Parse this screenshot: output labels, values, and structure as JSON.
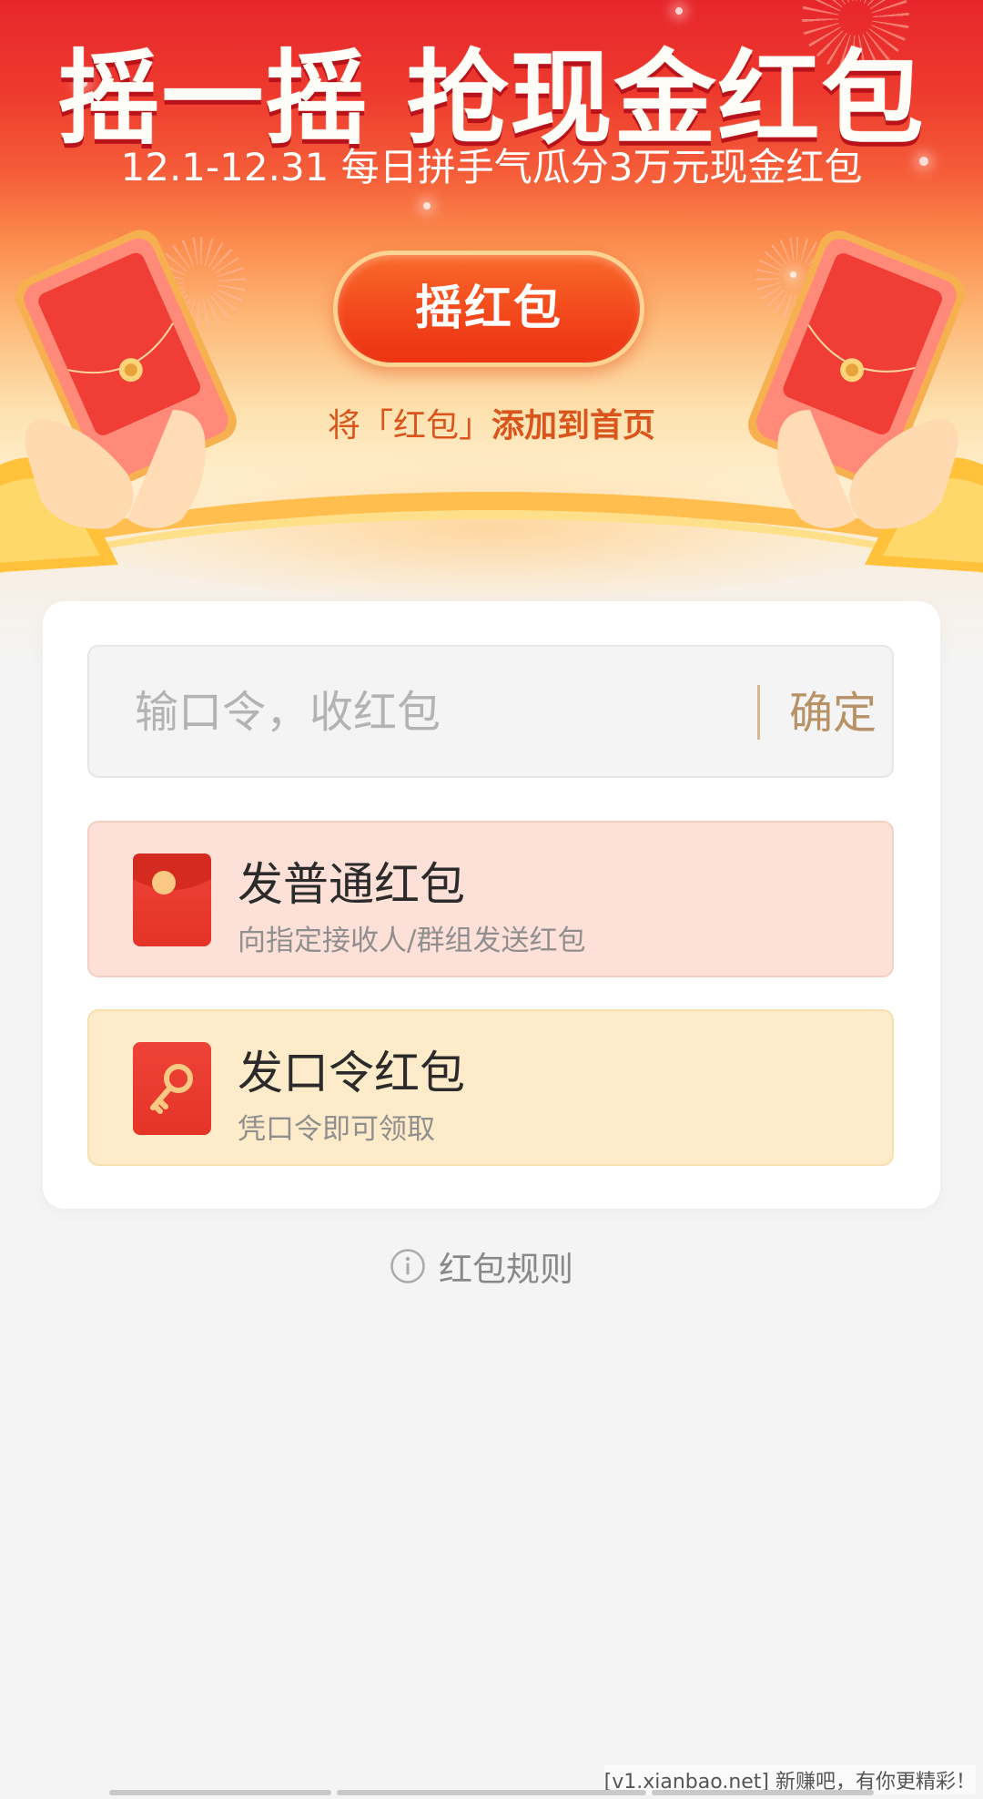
{
  "hero": {
    "title": "摇一摇 抢现金红包",
    "subtitle": "12.1-12.31 每日拼手气瓜分3万元现金红包",
    "shake_button": "摇红包",
    "add_home_prefix": "将「红包」",
    "add_home_link": "添加到首页"
  },
  "code_box": {
    "placeholder": "输口令，收红包",
    "value": "",
    "confirm_label": "确定"
  },
  "options": [
    {
      "title": "发普通红包",
      "desc": "向指定接收人/群组发送红包",
      "icon": "red-envelope-icon"
    },
    {
      "title": "发口令红包",
      "desc": "凭口令即可领取",
      "icon": "key-icon"
    }
  ],
  "rules": {
    "label": "红包规则",
    "icon": "info-icon"
  },
  "watermark": "[v1.xianbao.net] 新赚吧，有你更精彩！",
  "colors": {
    "primary_red": "#e53328",
    "accent_orange": "#f2451b",
    "gold_text": "#b89267",
    "background": "#f4f4f4"
  }
}
